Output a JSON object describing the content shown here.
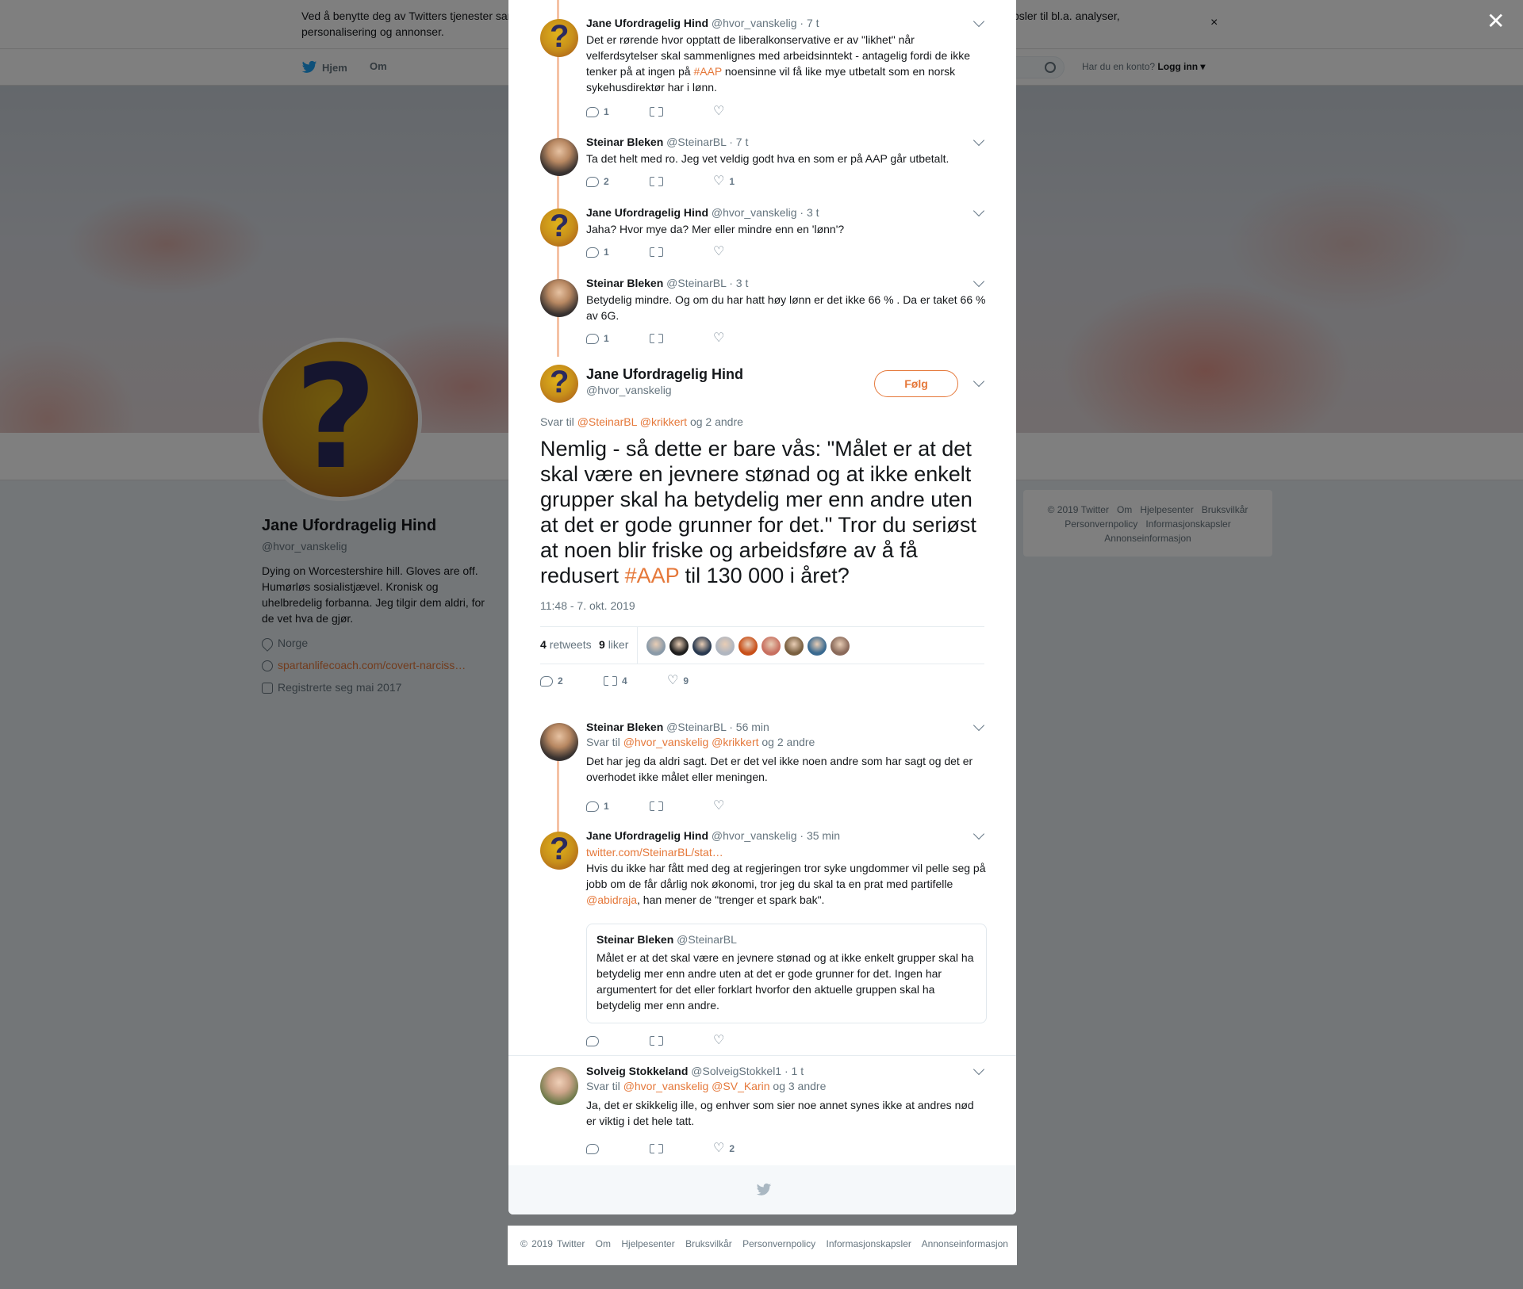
{
  "cookie": {
    "text": "Ved å benytte deg av Twitters tjenester samtykker du til vår bruk av informasjonskapsler og deling av data med partnere gjennom informasjonskapsler til bl.a. analyser, personalisering og annonser.",
    "close": "×"
  },
  "nav": {
    "home": "Hjem",
    "about": "Om",
    "login_prompt": "Har du en konto?",
    "login": "Logg inn ▾"
  },
  "profile": {
    "name": "Jane Ufordragelig Hind",
    "handle": "@hvor_vanskelig",
    "bio": "Dying on Worcestershire hill. Gloves are off. Humørløs sosialistjævel. Kronisk og uhelbredelig forbanna. Jeg tilgir dem aldri, for de vet hva de gjør.",
    "location": "Norge",
    "link": "spartanlifecoach.com/covert-narciss…",
    "joined": "Registrerte seg mai 2017"
  },
  "right_footer": [
    "© 2019 Twitter",
    "Om",
    "Hjelpesenter",
    "Bruksvilkår",
    "Personvernpolicy",
    "Informasjonskapsler",
    "Annonseinformasjon"
  ],
  "overlay_close": "✕",
  "thread": [
    {
      "name": "Jane Ufordragelig Hind",
      "handle": "@hvor_vanskelig",
      "time": "· 7 t",
      "text_a": "Det er rørende hvor opptatt de liberalkonservative er av \"likhet\" når velferdsytelser skal sammenlignes med arbeidsinntekt - antagelig fordi de ikke tenker på at ingen på ",
      "hashtag": "#AAP",
      "text_b": " noensinne vil få like mye utbetalt som en norsk sykehusdirektør har i lønn.",
      "replies": "1",
      "retweets": "",
      "likes": ""
    },
    {
      "name": "Steinar Bleken",
      "handle": "@SteinarBL",
      "time": "· 7 t",
      "text": "Ta det helt med ro. Jeg vet veldig godt hva en som er på AAP går utbetalt.",
      "replies": "2",
      "retweets": "",
      "likes": "1"
    },
    {
      "name": "Jane Ufordragelig Hind",
      "handle": "@hvor_vanskelig",
      "time": "· 3 t",
      "text": "Jaha? Hvor mye da? Mer eller mindre enn en 'lønn'?",
      "replies": "1",
      "retweets": "",
      "likes": ""
    },
    {
      "name": "Steinar Bleken",
      "handle": "@SteinarBL",
      "time": "· 3 t",
      "text": "Betydelig mindre. Og om du har hatt høy lønn er det ikke 66 % . Da er taket 66 % av 6G.",
      "replies": "1",
      "retweets": "",
      "likes": ""
    }
  ],
  "main": {
    "name": "Jane Ufordragelig Hind",
    "handle": "@hvor_vanskelig",
    "follow": "Følg",
    "reply_prefix": "Svar til",
    "reply_users": "@SteinarBL @krikkert",
    "reply_suffix": "og 2 andre",
    "text_a": "Nemlig - så dette er bare vås: \"Målet er at det skal være en jevnere stønad og at ikke enkelt grupper skal ha betydelig mer enn andre uten at det er gode grunner for det.\" Tror du seriøst at noen blir friske og arbeidsføre av å få redusert ",
    "hashtag": "#AAP",
    "text_b": " til 130 000 i året?",
    "time": "11:48 - 7. okt. 2019",
    "retweets_count": "4",
    "retweets_label": "retweets",
    "likes_count": "9",
    "likes_label": "liker",
    "liker_colors": [
      "#8a9aa8",
      "#1e1e1e",
      "#2a3a50",
      "#b0b6c0",
      "#c8501a",
      "#c87060",
      "#7a6040",
      "#3a6a90",
      "#8a6a5a"
    ],
    "replies": "2",
    "retweets": "4",
    "likes": "9"
  },
  "replies": [
    {
      "name": "Steinar Bleken",
      "handle": "@SteinarBL",
      "time": "· 56 min",
      "reply_prefix": "Svar til",
      "reply_users": "@hvor_vanskelig @krikkert",
      "reply_suffix": "og 2 andre",
      "text": "Det har jeg da aldri sagt. Det er det vel ikke noen andre som har sagt og det er overhodet ikke målet eller meningen.",
      "replies": "1",
      "retweets": "",
      "likes": ""
    },
    {
      "name": "Jane Ufordragelig Hind",
      "handle": "@hvor_vanskelig",
      "time": "· 35 min",
      "link": "twitter.com/SteinarBL/stat…",
      "text_a": "Hvis du ikke har fått med deg at regjeringen tror syke ungdommer vil pelle seg på jobb om de får dårlig nok økonomi, tror jeg du skal ta en prat med partifelle ",
      "mention": "@abidraja",
      "text_b": ", han mener de \"trenger et spark bak\".",
      "quote_name": "Steinar Bleken",
      "quote_handle": "@SteinarBL",
      "quote_text": "Målet er at det skal være en jevnere stønad og at ikke enkelt grupper skal ha betydelig mer enn andre uten at det er gode grunner for det. Ingen har argumentert for det eller forklart hvorfor den aktuelle gruppen skal ha betydelig mer enn andre.",
      "replies": "",
      "retweets": "",
      "likes": ""
    },
    {
      "name": "Solveig Stokkeland",
      "handle": "@SolveigStokkel1",
      "time": "· 1 t",
      "reply_prefix": "Svar til",
      "reply_users": "@hvor_vanskelig @SV_Karin",
      "reply_suffix": "og 3 andre",
      "text": "Ja, det er skikkelig ille, og enhver som sier noe annet synes ikke at andres nød er viktig i det hele tatt.",
      "replies": "",
      "retweets": "",
      "likes": "2"
    }
  ],
  "modal_footer": [
    "© 2019 Twitter",
    "Om",
    "Hjelpesenter",
    "Bruksvilkår",
    "Personvernpolicy",
    "Informasjonskapsler",
    "Annonseinformasjon"
  ],
  "colors": {
    "accent": "#e5783a",
    "muted": "#66757f",
    "thread_line": "#f5c2a5"
  }
}
